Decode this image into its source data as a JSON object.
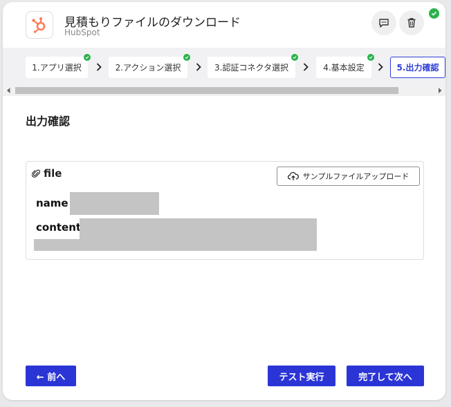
{
  "header": {
    "title": "見積もりファイルのダウンロード",
    "subtitle": "HubSpot",
    "logo_icon": "hubspot-logo",
    "accent": "#ff7a59"
  },
  "steps": [
    {
      "label": "1.アプリ選択",
      "done": true,
      "active": false
    },
    {
      "label": "2.アクション選択",
      "done": true,
      "active": false
    },
    {
      "label": "3.認証コネクタ選択",
      "done": true,
      "active": false
    },
    {
      "label": "4.基本設定",
      "done": true,
      "active": false
    },
    {
      "label": "5.出力確認",
      "done": false,
      "active": true
    }
  ],
  "main": {
    "section_title": "出力確認",
    "file": {
      "label": "file",
      "upload_button": "サンプルファイルアップロード",
      "fields": [
        "name",
        "content"
      ]
    }
  },
  "footer": {
    "back_label": "← 前へ",
    "test_label": "テスト実行",
    "next_label": "完了して次へ"
  },
  "colors": {
    "primary": "#2b35d6",
    "success": "#2bb24c"
  }
}
